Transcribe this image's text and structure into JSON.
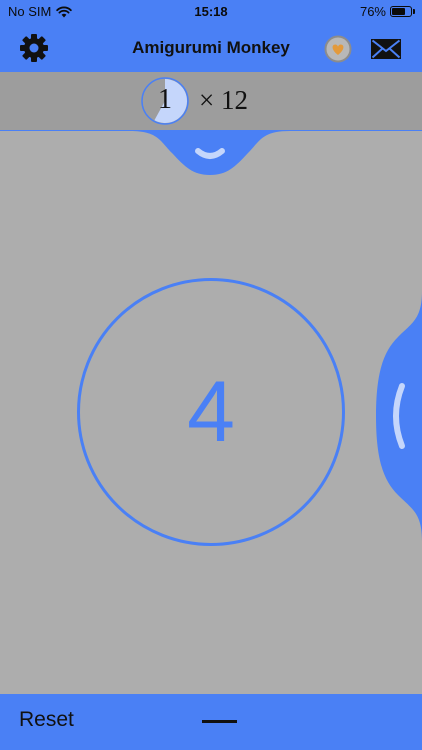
{
  "status_bar": {
    "carrier": "No SIM",
    "time": "15:18",
    "battery_text": "76%",
    "battery_level": 0.76
  },
  "header": {
    "title": "Amigurumi Monkey",
    "icons": [
      "gear-icon",
      "heart-badge-icon",
      "mail-icon"
    ]
  },
  "stitch_counter": {
    "count": "1",
    "multiplier": "× 12",
    "progress": 0.58
  },
  "row_counter": {
    "value": "4"
  },
  "bottom_bar": {
    "reset_label": "Reset",
    "decrement_icon": "minus-icon"
  },
  "colors": {
    "accent": "#4a80f5",
    "background": "#adadad",
    "stitch_bar": "#9d9d9d",
    "pie_fill": "#c5d6fb",
    "heart": "#e39a3c"
  }
}
